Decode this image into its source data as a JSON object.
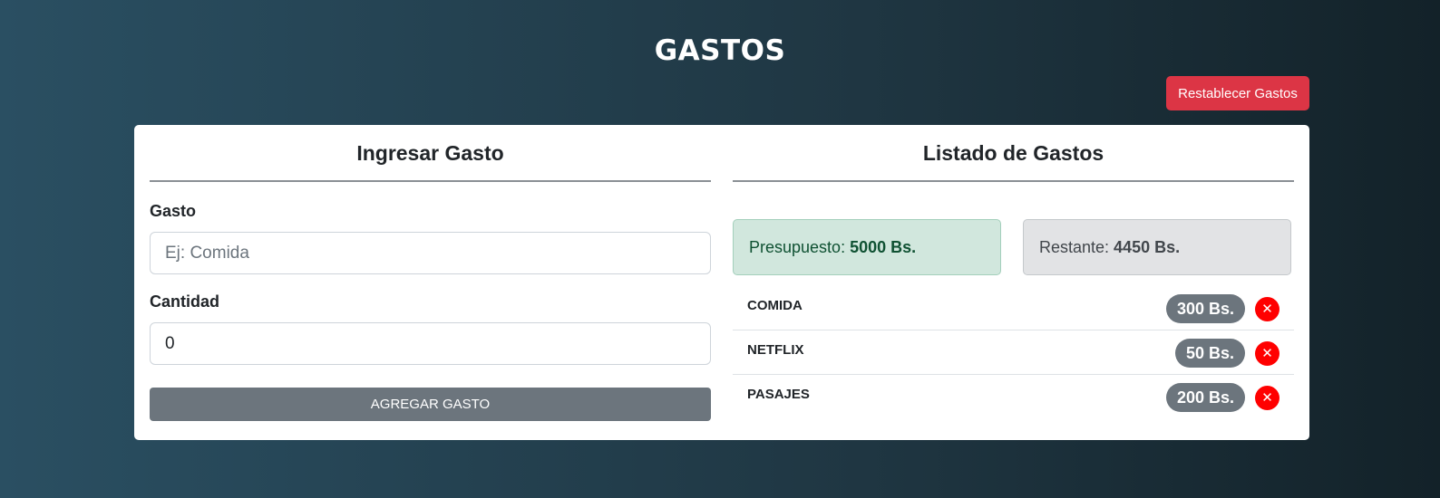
{
  "header": {
    "title": "GASTOS",
    "reset_label": "Restablecer Gastos"
  },
  "form": {
    "title": "Ingresar Gasto",
    "gasto_label": "Gasto",
    "gasto_placeholder": "Ej: Comida",
    "cantidad_label": "Cantidad",
    "cantidad_value": "0",
    "submit_label": "AGREGAR GASTO"
  },
  "list": {
    "title": "Listado de Gastos",
    "presupuesto_label": "Presupuesto:",
    "presupuesto_value": "5000 Bs.",
    "restante_label": "Restante:",
    "restante_value": "4450 Bs.",
    "items": [
      {
        "name": "COMIDA",
        "amount": "300 Bs.",
        "delete_icon": "close-icon"
      },
      {
        "name": "NETFLIX",
        "amount": "50 Bs.",
        "delete_icon": "close-icon"
      },
      {
        "name": "PASAJES",
        "amount": "200 Bs.",
        "delete_icon": "close-icon"
      }
    ]
  },
  "colors": {
    "danger": "#dc3545",
    "secondary": "#6c757d",
    "success_bg": "#d1e7dd",
    "delete": "#ff0000"
  }
}
